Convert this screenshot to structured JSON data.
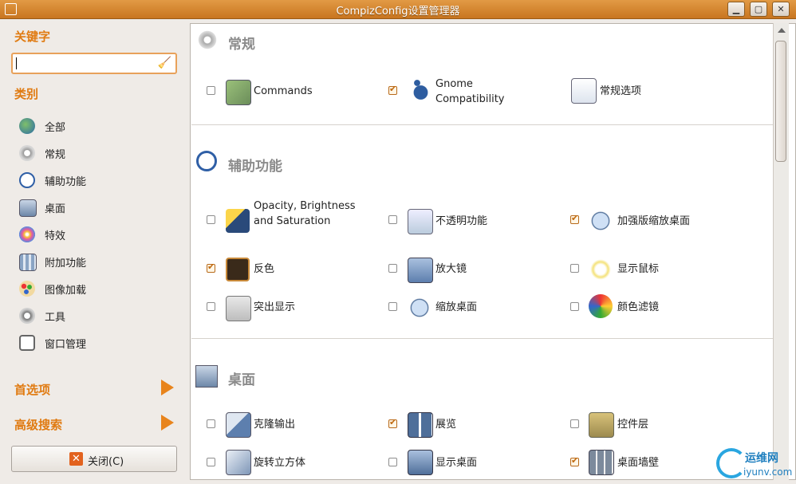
{
  "window": {
    "title": "CompizConfig设置管理器",
    "minimize": "▁",
    "maximize": "▢",
    "close": "✕"
  },
  "sidebar": {
    "filter_heading": "关键字",
    "search_value": "",
    "category_heading": "类别",
    "categories": [
      {
        "label": "全部",
        "icon": "globe-icon"
      },
      {
        "label": "常规",
        "icon": "gears-icon"
      },
      {
        "label": "辅助功能",
        "icon": "accessibility-icon"
      },
      {
        "label": "桌面",
        "icon": "desktop-icon"
      },
      {
        "label": "特效",
        "icon": "effects-icon"
      },
      {
        "label": "附加功能",
        "icon": "extras-icon"
      },
      {
        "label": "图像加载",
        "icon": "image-icon"
      },
      {
        "label": "工具",
        "icon": "tools-icon"
      },
      {
        "label": "窗口管理",
        "icon": "window-icon"
      }
    ],
    "preferences": "首选项",
    "advanced_search": "高级搜索",
    "close_label": "关闭(C)"
  },
  "sections": [
    {
      "title": "常规",
      "plugins": [
        {
          "label": "Commands",
          "checked": false
        },
        {
          "label": "Gnome Compatibility",
          "checked": true
        },
        {
          "label": "常规选项",
          "checked": null
        }
      ]
    },
    {
      "title": "辅助功能",
      "plugins": [
        {
          "label": "Opacity, Brightness and Saturation",
          "checked": false
        },
        {
          "label": "不透明功能",
          "checked": false
        },
        {
          "label": "加强版缩放桌面",
          "checked": true
        },
        {
          "label": "反色",
          "checked": true
        },
        {
          "label": "放大镜",
          "checked": false
        },
        {
          "label": "显示鼠标",
          "checked": false
        },
        {
          "label": "突出显示",
          "checked": false
        },
        {
          "label": "缩放桌面",
          "checked": false
        },
        {
          "label": "颜色滤镜",
          "checked": false
        }
      ]
    },
    {
      "title": "桌面",
      "plugins": [
        {
          "label": "克隆输出",
          "checked": false
        },
        {
          "label": "展览",
          "checked": true
        },
        {
          "label": "控件层",
          "checked": false
        },
        {
          "label": "旋转立方体",
          "checked": false
        },
        {
          "label": "显示桌面",
          "checked": false
        },
        {
          "label": "桌面墙壁",
          "checked": true
        }
      ]
    }
  ],
  "watermark": {
    "text1": "运维网",
    "text2": "iyunv.com"
  },
  "colors": {
    "accent": "#e07b12",
    "titlebar": "#d9852e"
  }
}
